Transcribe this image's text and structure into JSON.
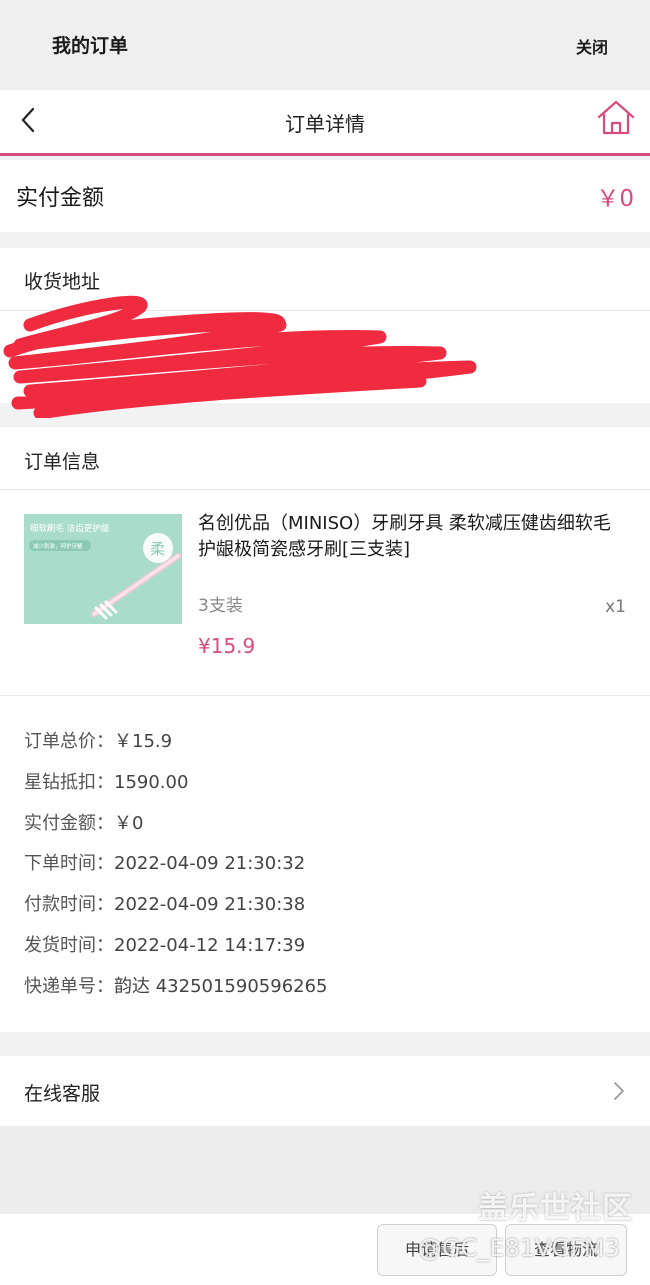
{
  "mini_header": {
    "title": "我的订单",
    "close_label": "关闭"
  },
  "nav": {
    "title": "订单详情",
    "back_icon": "chevron-left-icon",
    "home_icon": "home-icon"
  },
  "payment": {
    "label": "实付金额",
    "value": "￥0"
  },
  "address": {
    "title": "收货地址"
  },
  "order": {
    "title": "订单信息",
    "product": {
      "name": "名创优品（MINISO）牙刷牙具 柔软减压健齿细软毛 护龈极简瓷感牙刷[三支装]",
      "spec": "3支装",
      "qty": "x1",
      "price": "¥15.9",
      "image": {
        "headline": "细软刷毛 洁齿更护龈",
        "subline": "减少刺激，呵护牙龈",
        "badge": "柔"
      }
    },
    "details": [
      {
        "label": "订单总价：",
        "value": "￥15.9"
      },
      {
        "label": "星钻抵扣：",
        "value": "1590.00"
      },
      {
        "label": "实付金额：",
        "value": "￥0"
      },
      {
        "label": "下单时间：",
        "value": "2022-04-09 21:30:32"
      },
      {
        "label": "付款时间：",
        "value": "2022-04-09 21:30:38"
      },
      {
        "label": "发货时间：",
        "value": "2022-04-12 14:17:39"
      },
      {
        "label": "快递单号：",
        "value": "韵达 432501590596265"
      }
    ]
  },
  "service": {
    "label": "在线客服",
    "arrow_icon": "chevron-right-icon"
  },
  "actions": {
    "after_sale": "申请售后",
    "logistics": "查看物流"
  },
  "watermark": {
    "brand": "盖乐世社区",
    "user": "@GC_E81VGFM3"
  },
  "colors": {
    "accent": "#d94b80",
    "background": "#f2f2f2",
    "product_bg": "#a9dccb"
  }
}
